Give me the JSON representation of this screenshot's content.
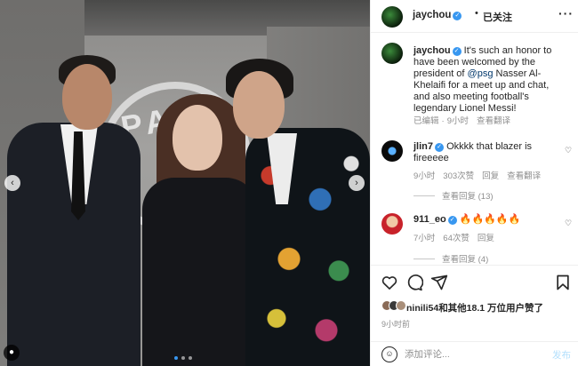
{
  "header": {
    "username": "jaychou",
    "separator": "•",
    "follow_label": "已关注",
    "more_label": "···"
  },
  "caption": {
    "username": "jaychou",
    "text_before": " It's such an honor to have been welcomed by the president of ",
    "mention": "@psg",
    "text_after": " Nasser Al-Khelaifi for a meet up and chat, and also meeting football's legendary Lionel Messi!",
    "edited": "已编辑",
    "dot": "·",
    "time": "9小时",
    "translate": "查看翻译"
  },
  "comments": [
    {
      "username": "jlin7",
      "text": " Okkkk that blazer is fireeeee",
      "time": "9小时",
      "likes": "303次赞",
      "reply": "回复",
      "translate": "查看翻译",
      "view_replies": "查看回复 (13)"
    },
    {
      "username": "911_eo",
      "text": " 🔥🔥🔥🔥🔥",
      "time": "7小时",
      "likes": "64次赞",
      "reply": "回复",
      "view_replies": "查看回复 (4)"
    }
  ],
  "likes": {
    "liker": "ninili54",
    "text": "和其他18.1 万位用户赞了"
  },
  "post_time": "9小时前",
  "composer": {
    "placeholder": "添加评论...",
    "post_label": "发布"
  },
  "photo": {
    "badge_text": "PA"
  },
  "colors": {
    "verified": "#3897f0",
    "mention": "#00376b",
    "muted": "#8e8e8e",
    "post_disabled": "#b2dffc"
  },
  "icons": {
    "heart": "heart-icon",
    "comment": "comment-icon",
    "share": "share-icon",
    "save": "bookmark-icon",
    "emoji": "emoji-icon",
    "verified": "verified-badge-icon",
    "prev": "chevron-left-icon",
    "next": "chevron-right-icon",
    "tag": "person-tag-icon"
  }
}
